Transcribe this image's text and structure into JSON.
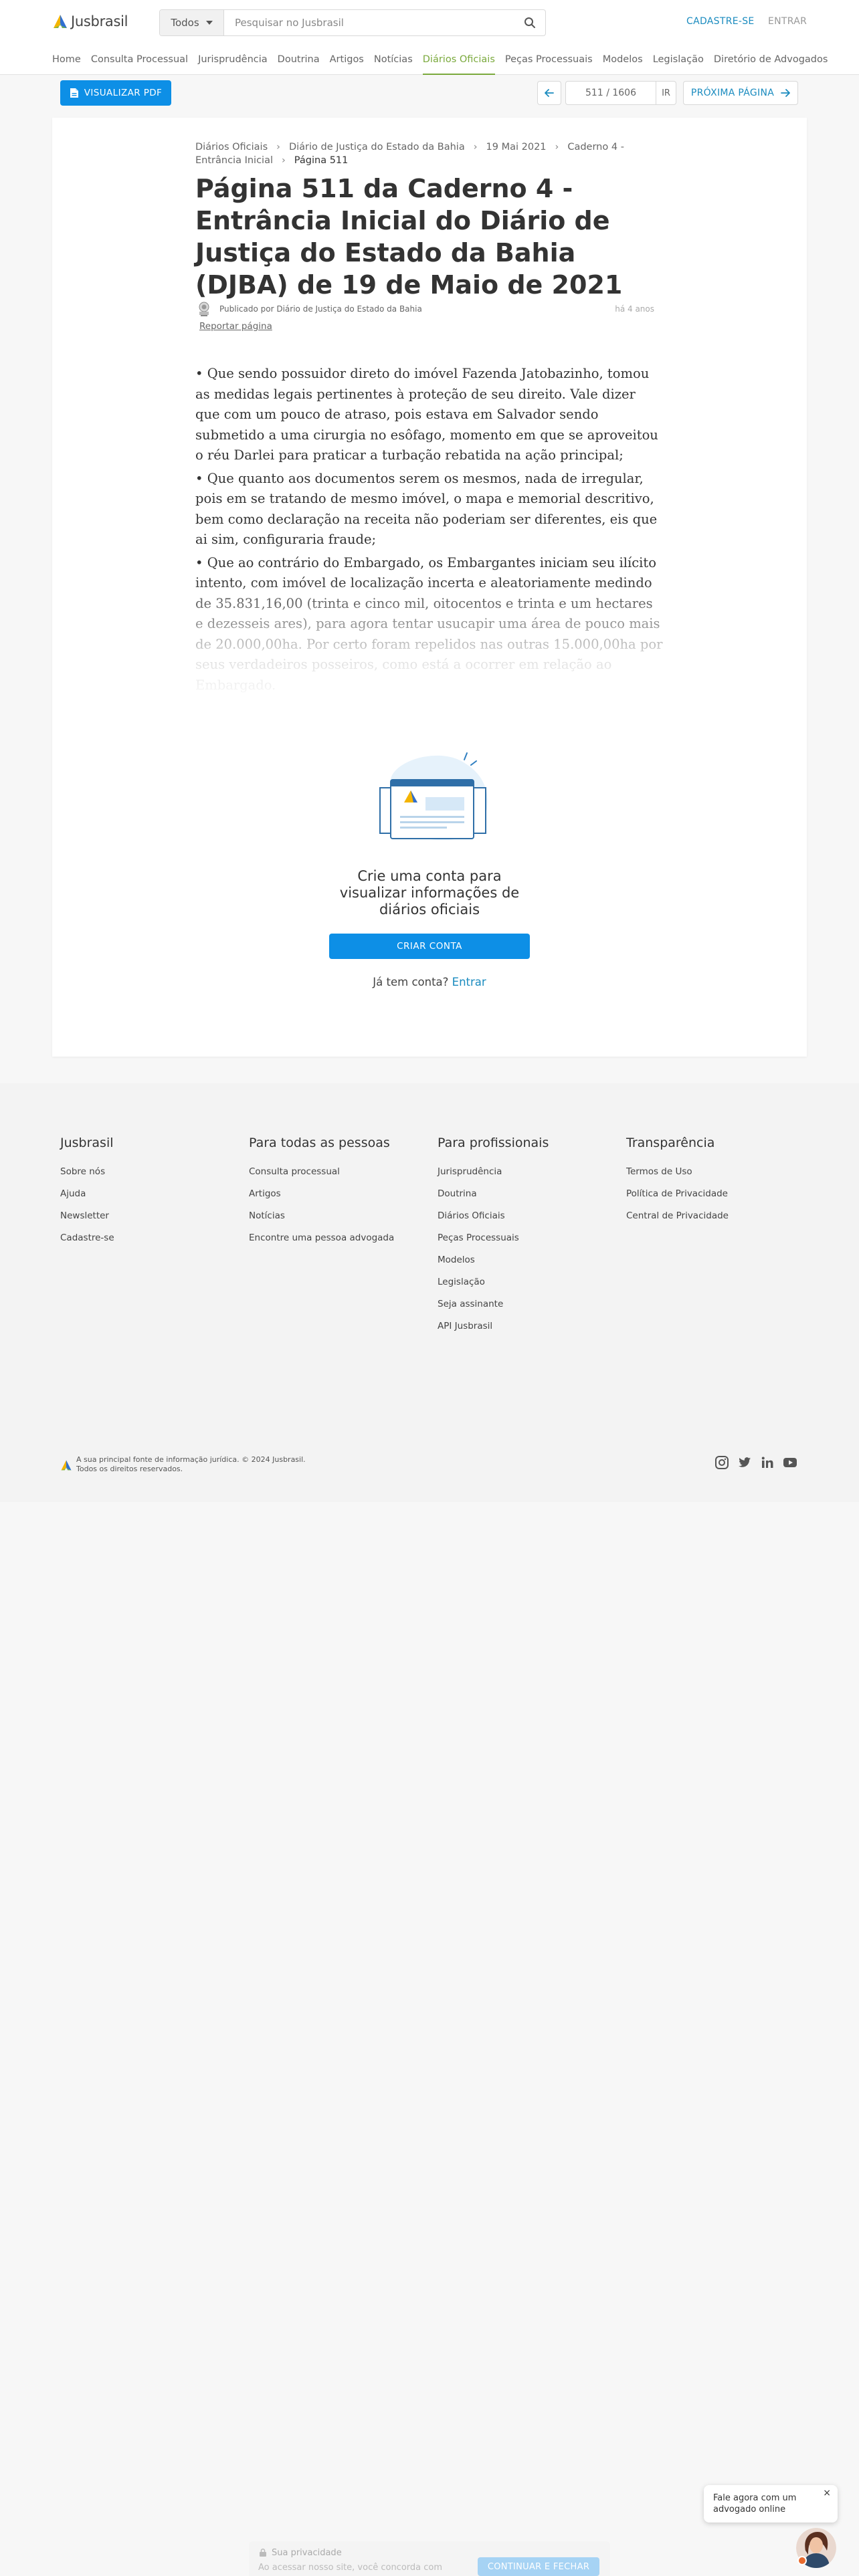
{
  "header": {
    "logo_text": "Jusbrasil",
    "search_scope": "Todos",
    "search_placeholder": "Pesquisar no Jusbrasil",
    "cadastre_label": "CADASTRE-SE",
    "entrar_label": "ENTRAR"
  },
  "nav": {
    "items": [
      {
        "label": "Home"
      },
      {
        "label": "Consulta Processual"
      },
      {
        "label": "Jurisprudência"
      },
      {
        "label": "Doutrina"
      },
      {
        "label": "Artigos"
      },
      {
        "label": "Notícias"
      },
      {
        "label": "Diários Oficiais"
      },
      {
        "label": "Peças Processuais"
      },
      {
        "label": "Modelos"
      },
      {
        "label": "Legislação"
      },
      {
        "label": "Diretório de Advogados"
      }
    ],
    "active": "Diários Oficiais"
  },
  "toolbar": {
    "pdf_label": "VISUALIZAR PDF",
    "page_value": "511 / 1606",
    "go_label": "IR",
    "next_label": "PRÓXIMA PÁGINA"
  },
  "breadcrumb": {
    "items": [
      "Diários Oficiais",
      "Diário de Justiça do Estado da Bahia",
      "19 Mai 2021",
      "Caderno 4 - Entrância Inicial"
    ],
    "current": "Página 511"
  },
  "page": {
    "title": "Página 511 da Caderno 4 - Entrância Inicial do Diário de Justiça do Estado da Bahia (DJBA) de 19 de Maio de 2021",
    "publisher": "Publicado por Diário de Justiça do Estado da Bahia",
    "time": "há 4 anos",
    "report_label": "Reportar página"
  },
  "document": {
    "paragraphs": [
      "• Que sendo possuidor direto do imóvel Fazenda Jatobazinho, tomou as medidas legais pertinentes à proteção de seu direito. Vale dizer que com um pouco de atraso, pois estava em Salvador sendo submetido a uma cirurgia no esôfago, momento em que se aproveitou o réu Darlei para praticar a turbação rebatida na ação principal;",
      "• Que quanto aos documentos serem os mesmos, nada de irregular, pois em se tratando de mesmo imóvel, o mapa e memorial descritivo, bem como declaração na receita não poderiam ser diferentes, eis que ai sim, configuraria fraude;",
      "• Que ao contrário do Embargado, os Embargantes iniciam seu ilícito intento, com imóvel de localização incerta e aleatoriamente medindo de 35.831,16,00 (trinta e cinco mil, oitocentos e trinta e um hectares e dezesseis ares), para agora tentar usucapir uma área de pouco mais de 20.000,00ha. Por certo foram repelidos nas outras 15.000,00ha por seus verdadeiros posseiros, como está a ocorrer em relação ao Embargado."
    ]
  },
  "signup": {
    "message": "Crie uma conta para visualizar informações de diários oficiais",
    "button_label": "CRIAR CONTA",
    "login_prompt": "Já tem conta?",
    "login_link": "Entrar"
  },
  "footer": {
    "columns": [
      {
        "title": "Jusbrasil",
        "links": [
          "Sobre nós",
          "Ajuda",
          "Newsletter",
          "Cadastre-se"
        ]
      },
      {
        "title": "Para todas as pessoas",
        "links": [
          "Consulta processual",
          "Artigos",
          "Notícias",
          "Encontre uma pessoa advogada"
        ]
      },
      {
        "title": "Para profissionais",
        "links": [
          "Jurisprudência",
          "Doutrina",
          "Diários Oficiais",
          "Peças Processuais",
          "Modelos",
          "Legislação",
          "Seja assinante",
          "API Jusbrasil"
        ]
      },
      {
        "title": "Transparência",
        "links": [
          "Termos de Uso",
          "Política de Privacidade",
          "Central de Privacidade"
        ]
      }
    ],
    "copyright_line1": "A sua principal fonte de informação jurídica. © 2024 Jusbrasil.",
    "copyright_line2": "Todos os direitos reservados.",
    "social_icons": [
      "instagram-icon",
      "twitter-icon",
      "linkedin-icon",
      "youtube-icon"
    ]
  },
  "chat": {
    "message": "Fale agora com um advogado online",
    "close_label": "×"
  },
  "privacy": {
    "title": "Sua privacidade",
    "text": "Ao acessar nosso site, você concorda com",
    "button_label": "CONTINUAR E FECHAR"
  },
  "colors": {
    "brand_blue": "#0d8fe6",
    "link_blue": "#1a8bbf",
    "nav_active_green": "#7aa93c"
  }
}
